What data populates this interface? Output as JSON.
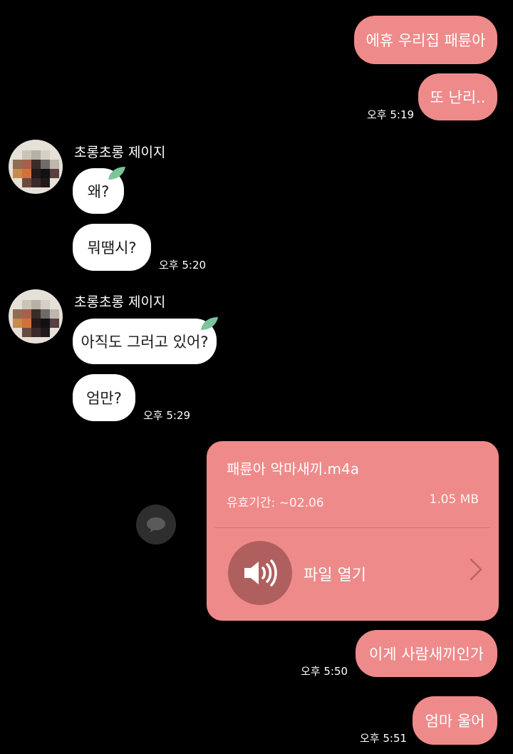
{
  "messages": {
    "out_1": "에휴 우리집 패륜아",
    "out_2": "또 난리..",
    "time_1": "오후 5:19",
    "sender_1": "초롱초롱 제이지",
    "in_1": "왜?",
    "in_2": "뭐땜시?",
    "time_2": "오후 5:20",
    "sender_2": "초롱초롱 제이지",
    "in_3": "아직도 그러고 있어?",
    "in_4": "엄만?",
    "time_3": "오후 5:29",
    "out_3": "이게 사람새끼인가",
    "time_4": "오후 5:50",
    "out_4": "엄마 울어",
    "time_5": "오후 5:51"
  },
  "file": {
    "name": "패륜아 악마새끼.m4a",
    "expiry": "유효기간: ~02.06",
    "size": "1.05 MB",
    "open_label": "파일 열기"
  },
  "icons": {
    "avatar": "pixelated-profile-photo",
    "leaf": "leaf-icon",
    "speaker": "speaker-icon",
    "chevron": "chevron-right-icon",
    "share": "share-speech-bubble-icon"
  },
  "colors": {
    "outgoing_bubble": "#ef8a8a",
    "incoming_bubble": "#ffffff",
    "background": "#000000",
    "leaf": "#7cc49a"
  }
}
